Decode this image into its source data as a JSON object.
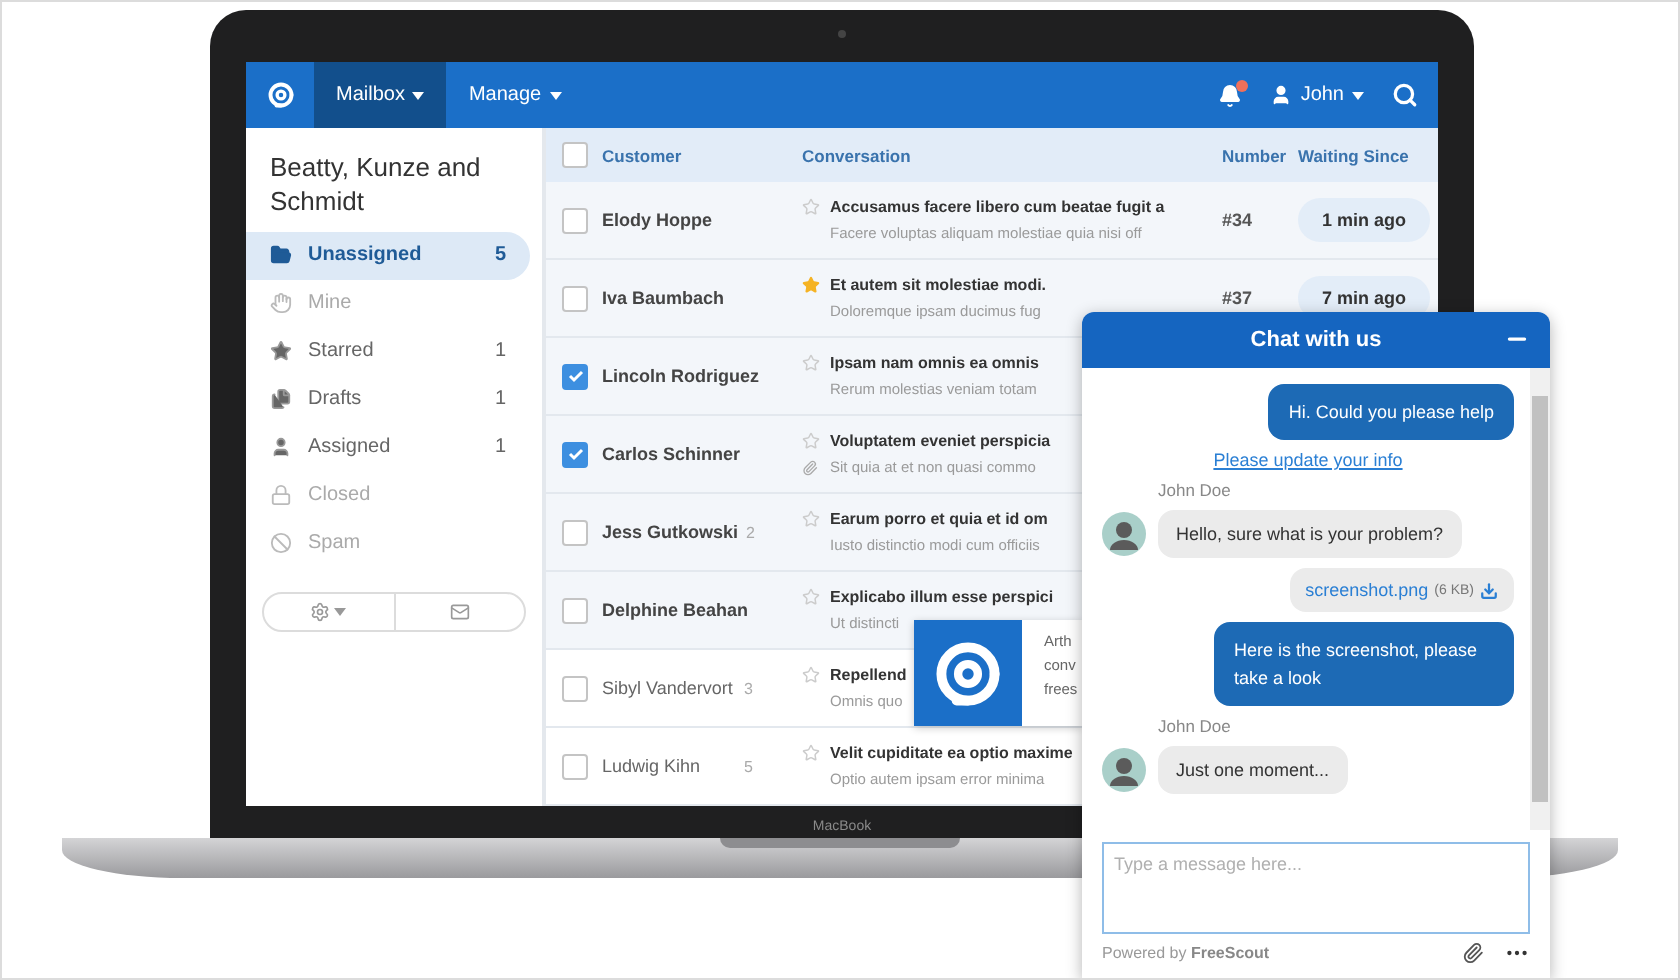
{
  "laptop": {
    "label": "MacBook"
  },
  "navbar": {
    "menus": [
      {
        "label": "Mailbox",
        "selected": true
      },
      {
        "label": "Manage",
        "selected": false
      }
    ],
    "notification": true,
    "user": "John"
  },
  "sidebar": {
    "title": "Beatty, Kunze and Schmidt",
    "items": [
      {
        "label": "Unassigned",
        "count": "5",
        "selected": true,
        "empty": false
      },
      {
        "label": "Mine",
        "selected": false,
        "empty": true
      },
      {
        "label": "Starred",
        "count": "1",
        "selected": false,
        "empty": false
      },
      {
        "label": "Drafts",
        "count": "1",
        "selected": false,
        "empty": false
      },
      {
        "label": "Assigned",
        "count": "1",
        "selected": false,
        "empty": false
      },
      {
        "label": "Closed",
        "selected": false,
        "empty": true
      },
      {
        "label": "Spam",
        "selected": false,
        "empty": true
      }
    ]
  },
  "table": {
    "all_checked": false,
    "columns": [
      "Customer",
      "Conversation",
      "Number",
      "Waiting Since"
    ],
    "rows": [
      {
        "customer": "Elody Hoppe",
        "unread": true,
        "checked": false,
        "starred": false,
        "attachment": false,
        "subject": "Accusamus facere libero cum beatae fugit a",
        "preview": "Facere voluptas aliquam molestiae quia nisi off",
        "number": "#34",
        "waiting": "1 min ago"
      },
      {
        "customer": "Iva Baumbach",
        "unread": true,
        "checked": false,
        "starred": true,
        "attachment": false,
        "subject": "Et autem sit molestiae modi.",
        "preview": "Doloremque ipsam ducimus fug",
        "number": "#37",
        "waiting": "7 min ago"
      },
      {
        "customer": "Lincoln Rodriguez",
        "unread": true,
        "checked": true,
        "starred": false,
        "attachment": false,
        "subject": "Ipsam nam omnis ea omnis",
        "preview": "Rerum molestias veniam totam"
      },
      {
        "customer": "Carlos Schinner",
        "unread": true,
        "checked": true,
        "starred": false,
        "attachment": true,
        "subject": "Voluptatem eveniet perspicia",
        "preview": "Sit quia at et non quasi commo"
      },
      {
        "customer": "Jess Gutkowski",
        "customer_count": "2",
        "unread": true,
        "checked": false,
        "starred": false,
        "attachment": false,
        "subject": "Earum porro et quia et id om",
        "preview": "Iusto distinctio modi cum officiis"
      },
      {
        "customer": "Delphine Beahan",
        "unread": true,
        "checked": false,
        "starred": false,
        "attachment": false,
        "subject": "Explicabo illum esse perspici",
        "preview": "Ut distincti"
      },
      {
        "customer": "Sibyl Vandervort",
        "customer_count": "3",
        "unread": false,
        "checked": false,
        "starred": false,
        "attachment": false,
        "subject": "Repellend",
        "preview": "Omnis quo"
      },
      {
        "customer": "Ludwig Kihn",
        "customer_count": "5",
        "unread": false,
        "checked": false,
        "starred": false,
        "attachment": false,
        "subject": "Velit cupiditate ea optio maxime",
        "preview": "Optio autem ipsam error minima"
      }
    ]
  },
  "popup": {
    "lines": [
      "Arth",
      "conv",
      "frees"
    ]
  },
  "chat": {
    "title": "Chat with us",
    "messages": [
      {
        "kind": "outgoing",
        "text": "Hi. Could you please help"
      },
      {
        "kind": "link",
        "text": "Please update your info"
      },
      {
        "kind": "sender",
        "text": "John Doe"
      },
      {
        "kind": "incoming",
        "text": "Hello, sure what is your problem?"
      },
      {
        "kind": "file",
        "text": "screenshot.png",
        "size": "(6 KB)"
      },
      {
        "kind": "outgoing",
        "text": "Here is the screenshot, please take a look"
      },
      {
        "kind": "sender",
        "text": "John Doe"
      },
      {
        "kind": "incoming",
        "text": "Just one moment..."
      }
    ],
    "placeholder": "Type a message here...",
    "footer": "Powered by **FreeScout**"
  }
}
